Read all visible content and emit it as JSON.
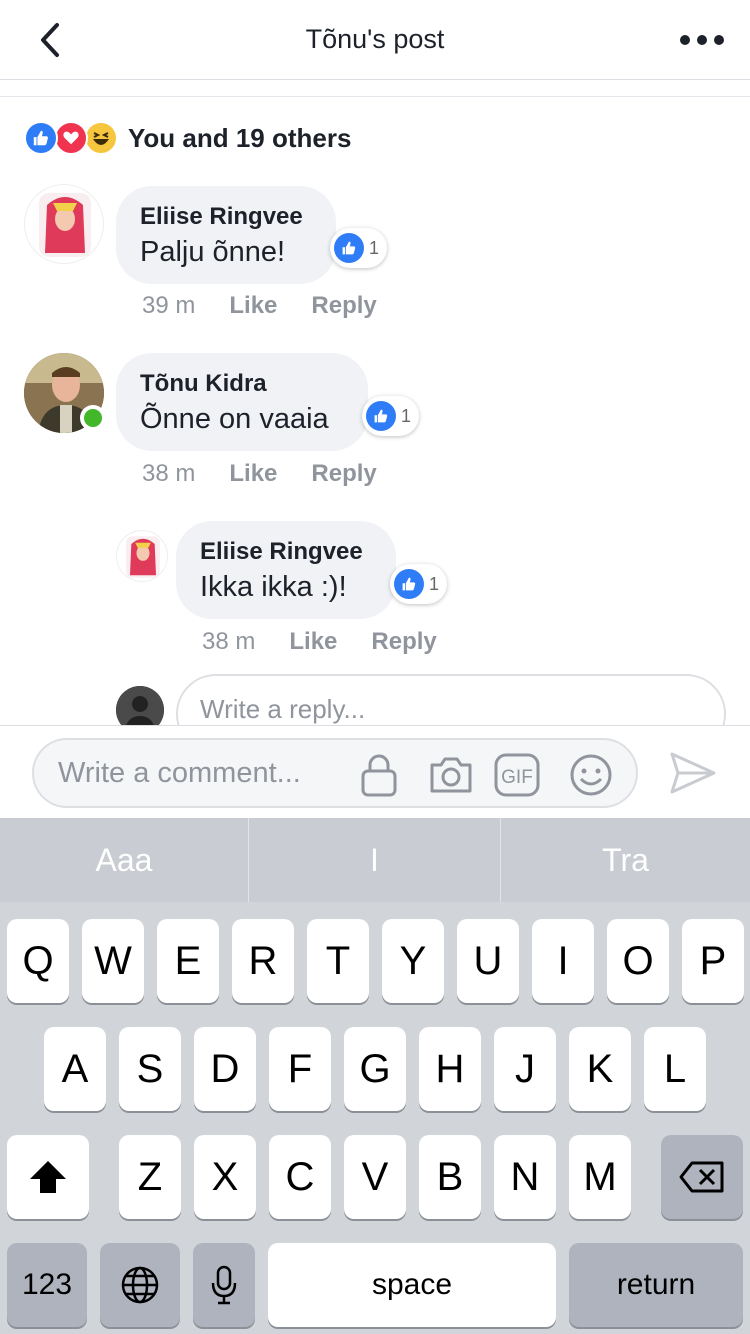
{
  "header": {
    "title": "Tõnu's post"
  },
  "reactions": {
    "summary": "You and 19 others",
    "types": [
      "like-icon",
      "love-icon",
      "haha-icon"
    ]
  },
  "comments": [
    {
      "author": "Eliise Ringvee",
      "text": "Palju õnne!",
      "likes": "1",
      "time": "39 m",
      "like_label": "Like",
      "reply_label": "Reply"
    },
    {
      "author": "Tõnu Kidra",
      "text": "Õnne on vaaia",
      "likes": "1",
      "time": "38 m",
      "like_label": "Like",
      "reply_label": "Reply",
      "online": true
    },
    {
      "author": "Eliise Ringvee",
      "text": "Ikka ikka :)!",
      "likes": "1",
      "time": "38 m",
      "like_label": "Like",
      "reply_label": "Reply",
      "is_reply": true
    }
  ],
  "reply_box": {
    "placeholder": "Write a reply..."
  },
  "composer": {
    "placeholder": "Write a comment...",
    "gif_label": "GIF"
  },
  "keyboard": {
    "suggestions": [
      "Aaa",
      "I",
      "Tra"
    ],
    "row1": [
      "Q",
      "W",
      "E",
      "R",
      "T",
      "Y",
      "U",
      "I",
      "O",
      "P"
    ],
    "row2": [
      "A",
      "S",
      "D",
      "F",
      "G",
      "H",
      "J",
      "K",
      "L"
    ],
    "row3": [
      "Z",
      "X",
      "C",
      "V",
      "B",
      "N",
      "M"
    ],
    "numbers_label": "123",
    "space_label": "space",
    "return_label": "return"
  },
  "colors": {
    "accent": "#2f7df6",
    "love": "#f0344f",
    "online": "#42b72a",
    "bubble": "#f0f2f5"
  }
}
